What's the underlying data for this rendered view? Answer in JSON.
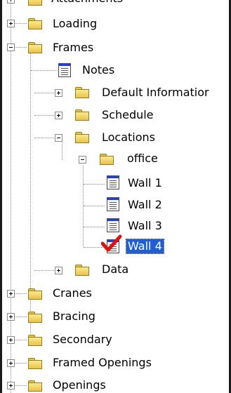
{
  "tree": {
    "top_partial_label": "Attachments",
    "items": {
      "loading": "Loading",
      "frames": "Frames",
      "notes": "Notes",
      "default_information": "Default Informatior",
      "schedule": "Schedule",
      "locations": "Locations",
      "office": "office",
      "wall1": "Wall 1",
      "wall2": "Wall 2",
      "wall3": "Wall 3",
      "wall4": "Wall 4",
      "data": "Data",
      "cranes": "Cranes",
      "bracing": "Bracing",
      "secondary": "Secondary",
      "framed_openings": "Framed Openings",
      "openings": "Openings"
    },
    "colors": {
      "selection": "#1f5fd6",
      "folder": "#e9c34d",
      "doc_header": "#1f3fd6",
      "check": "#e01010"
    }
  }
}
